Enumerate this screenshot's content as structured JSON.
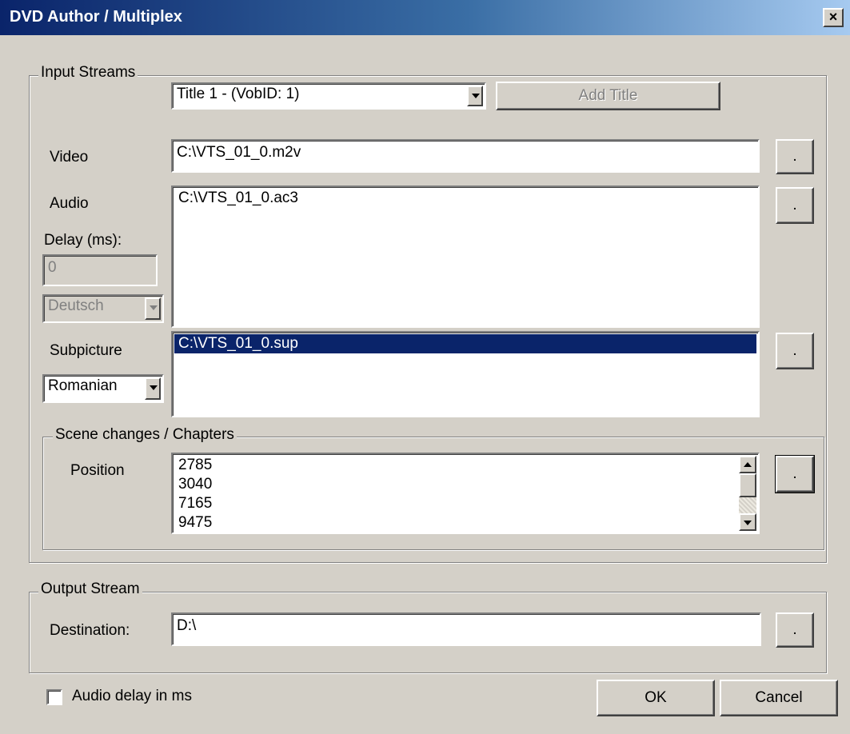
{
  "window": {
    "title": "DVD Author / Multiplex",
    "close_label": "×"
  },
  "input_streams": {
    "legend": "Input Streams",
    "title_select": {
      "value": "Title 1 - (VobID: 1)"
    },
    "add_title_label": "Add Title",
    "video": {
      "label": "Video",
      "value": "C:\\VTS_01_0.m2v",
      "browse_label": "."
    },
    "audio": {
      "label": "Audio",
      "items": [
        "C:\\VTS_01_0.ac3"
      ],
      "browse_label": ".",
      "delay_label": "Delay (ms):",
      "delay_value": "0",
      "language": "Deutsch"
    },
    "subpicture": {
      "label": "Subpicture",
      "items": [
        "C:\\VTS_01_0.sup"
      ],
      "language": "Romanian",
      "browse_label": "."
    },
    "chapters": {
      "legend": "Scene changes / Chapters",
      "position_label": "Position",
      "items": [
        "2785",
        "3040",
        "7165",
        "9475"
      ],
      "browse_label": "."
    }
  },
  "output_stream": {
    "legend": "Output Stream",
    "destination_label": "Destination:",
    "destination_value": "D:\\",
    "browse_label": "."
  },
  "audio_delay_checkbox": {
    "label": "Audio delay in ms",
    "checked": false
  },
  "buttons": {
    "ok": "OK",
    "cancel": "Cancel"
  },
  "colors": {
    "face": "#d4d0c8",
    "selection": "#0a246a",
    "title_start": "#0a246a",
    "title_end": "#a6caf0"
  }
}
